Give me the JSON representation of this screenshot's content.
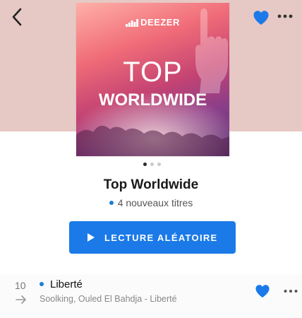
{
  "header": {
    "back_icon": "chevron-left-icon",
    "favorite_icon": "heart-icon",
    "more_icon": "more-horizontal-icon",
    "accent_color": "#1b7ae8"
  },
  "cover": {
    "brand": "DEEZER",
    "line1": "TOP",
    "line2": "WORLDWIDE"
  },
  "pager": {
    "pages": 3,
    "active_index": 0
  },
  "playlist": {
    "title": "Top Worldwide",
    "subtitle": "4 nouveaux titres"
  },
  "shuffle": {
    "label": "LECTURE ALÉATOIRE",
    "icon": "play-icon"
  },
  "tracks": [
    {
      "number": "10",
      "title": "Liberté",
      "artist": "Soolking, Ouled El Bahdja - Liberté",
      "trend_icon": "arrow-right-icon",
      "new": true,
      "favorite": true
    }
  ]
}
